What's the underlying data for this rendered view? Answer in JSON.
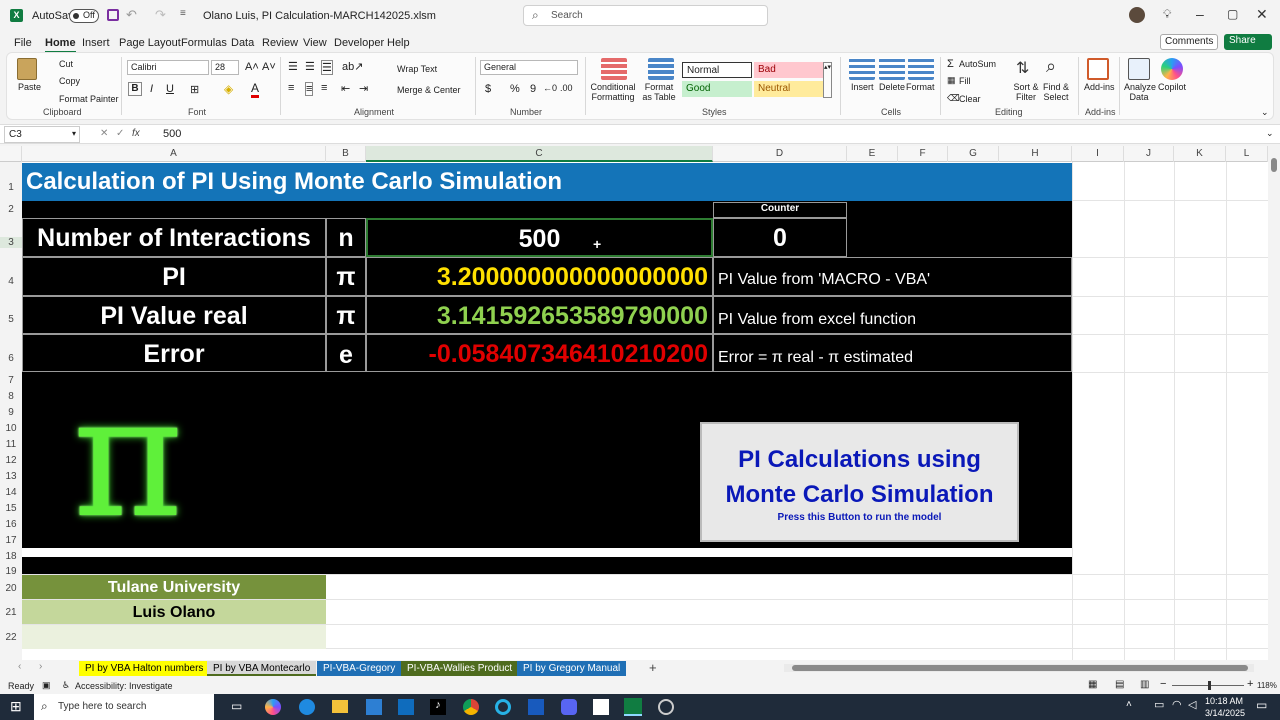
{
  "titlebar": {
    "autosave_label": "AutoSave",
    "autosave_state": "Off",
    "filename": "Olano Luis, PI Calculation-MARCH142025.xlsm",
    "search_placeholder": "Search"
  },
  "menu": [
    "File",
    "Home",
    "Insert",
    "Page Layout",
    "Formulas",
    "Data",
    "Review",
    "View",
    "Developer",
    "Help"
  ],
  "actions": {
    "comments": "Comments",
    "share": "Share"
  },
  "ribbon": {
    "clipboard": {
      "paste": "Paste",
      "cut": "Cut",
      "copy": "Copy",
      "format_painter": "Format Painter",
      "label": "Clipboard"
    },
    "font": {
      "name": "Calibri",
      "size": "28",
      "label": "Font",
      "bold": "B",
      "italic": "I",
      "underline": "U"
    },
    "alignment": {
      "wrap": "Wrap Text",
      "merge": "Merge & Center",
      "label": "Alignment"
    },
    "number": {
      "format": "General",
      "label": "Number",
      "currency": "$",
      "percent": "%",
      "comma": "9"
    },
    "styles": {
      "conditional": "Conditional Formatting",
      "format_table": "Format as Table",
      "normal": "Normal",
      "bad": "Bad",
      "good": "Good",
      "neutral": "Neutral",
      "label": "Styles"
    },
    "cells": {
      "insert": "Insert",
      "delete": "Delete",
      "format": "Format",
      "label": "Cells"
    },
    "editing": {
      "autosum": "AutoSum",
      "fill": "Fill",
      "clear": "Clear",
      "sort": "Sort & Filter",
      "find": "Find & Select",
      "label": "Editing"
    },
    "addins": {
      "addins": "Add-ins",
      "analyze": "Analyze Data",
      "copilot": "Copilot",
      "label": "Add-ins"
    }
  },
  "formula": {
    "cellref": "C3",
    "fx": "fx",
    "value": "500"
  },
  "columns": [
    "A",
    "B",
    "C",
    "D",
    "E",
    "F",
    "G",
    "H",
    "I",
    "J",
    "K",
    "L"
  ],
  "rows": [
    "1",
    "2",
    "3",
    "4",
    "5",
    "6",
    "7",
    "8",
    "9",
    "10",
    "11",
    "12",
    "13",
    "14",
    "15",
    "16",
    "17",
    "18",
    "19",
    "20",
    "21",
    "22"
  ],
  "sheet": {
    "title": "Calculation of  PI Using Monte Carlo Simulation",
    "counter_label": "Counter",
    "r3": {
      "label": "Number of Interactions",
      "sym": "n",
      "value": "500",
      "counter": "0"
    },
    "r4": {
      "label": "PI",
      "sym": "π",
      "value": "3.200000000000000000",
      "desc": "PI Value from 'MACRO - VBA'"
    },
    "r5": {
      "label": "PI Value real",
      "sym": "π",
      "value": "3.141592653589790000",
      "desc": "PI Value from excel function"
    },
    "r6": {
      "label": "Error",
      "sym": "e",
      "value": "-0.058407346410210200",
      "desc": "Error = π real - π estimated"
    },
    "button_title": "PI Calculations using Monte Carlo Simulation",
    "button_sub": "Press this Button to run the model",
    "university": "Tulane University",
    "author": "Luis Olano"
  },
  "tabs": [
    {
      "label": "PI by VBA Halton numbers",
      "color": "#ffff00",
      "text": "#000000"
    },
    {
      "label": "PI by VBA Montecarlo",
      "color": "#d8d8d8",
      "text": "#000000"
    },
    {
      "label": "PI-VBA-Gregory",
      "color": "#1f6fb5",
      "text": "#ffffff"
    },
    {
      "label": "PI-VBA-Wallies Product",
      "color": "#4e6b1e",
      "text": "#ffffff"
    },
    {
      "label": "PI by Gregory Manual",
      "color": "#1f6fb5",
      "text": "#ffffff"
    }
  ],
  "status": {
    "ready": "Ready",
    "accessibility": "Accessibility: Investigate",
    "zoom": "118%"
  },
  "taskbar": {
    "search": "Type here to search",
    "time": "10:18 AM",
    "date": "3/14/2025"
  }
}
